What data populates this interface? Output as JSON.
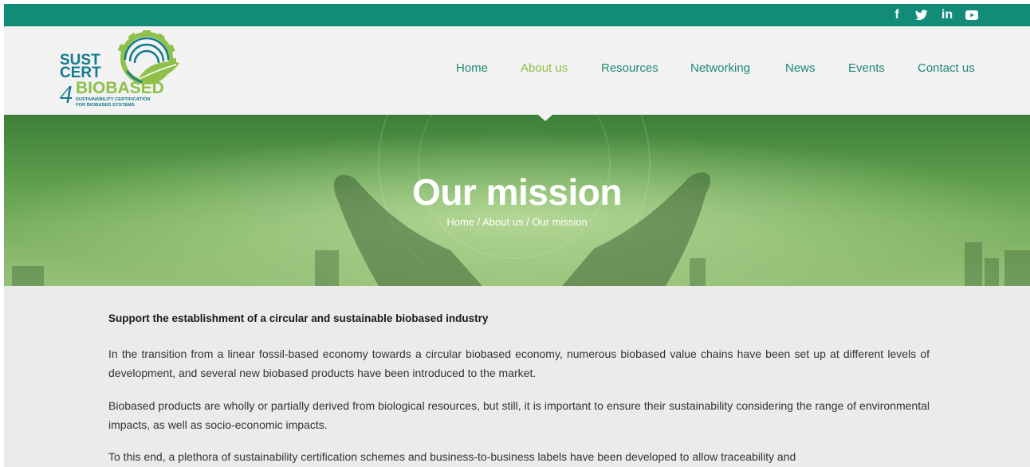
{
  "social": {
    "facebook": "f",
    "icons": [
      "facebook-icon",
      "twitter-icon",
      "linkedin-icon",
      "youtube-icon"
    ],
    "linkedin": "in"
  },
  "logo": {
    "line1": "SUST",
    "line2": "CERT",
    "digit": "4",
    "brand": "BIOBASED",
    "tagline1": "SUSTAINABILITY CERTIFICATION",
    "tagline2": "FOR BIOBASED SYSTEMS"
  },
  "nav": {
    "items": [
      {
        "label": "Home",
        "active": false
      },
      {
        "label": "About us",
        "active": true
      },
      {
        "label": "Resources",
        "active": false
      },
      {
        "label": "Networking",
        "active": false
      },
      {
        "label": "News",
        "active": false
      },
      {
        "label": "Events",
        "active": false
      },
      {
        "label": "Contact us",
        "active": false
      }
    ]
  },
  "hero": {
    "title": "Our mission",
    "breadcrumb": [
      "Home",
      "About us",
      "Our mission"
    ],
    "separator": " / "
  },
  "content": {
    "heading": "Support the establishment of a circular and sustainable biobased industry",
    "paragraphs": [
      "In the transition from a linear fossil-based economy towards a circular biobased economy, numerous biobased value chains have been set up at different levels of development, and several new biobased products have been introduced to the market.",
      "Biobased products are wholly or partially derived from biological resources, but still, it is important to ensure their sustainability considering the range of environmental impacts, as well as socio-economic impacts.",
      "To this end, a plethora of sustainability certification schemes and business-to-business labels have been developed to allow traceability and"
    ]
  },
  "colors": {
    "topbar": "#138b79",
    "nav_text": "#1e8a73",
    "nav_active": "#8fc04a",
    "header_bg": "#f2f2f2",
    "content_bg": "#ebebea",
    "logo_blue": "#127a8c",
    "logo_green": "#8fc04a"
  }
}
